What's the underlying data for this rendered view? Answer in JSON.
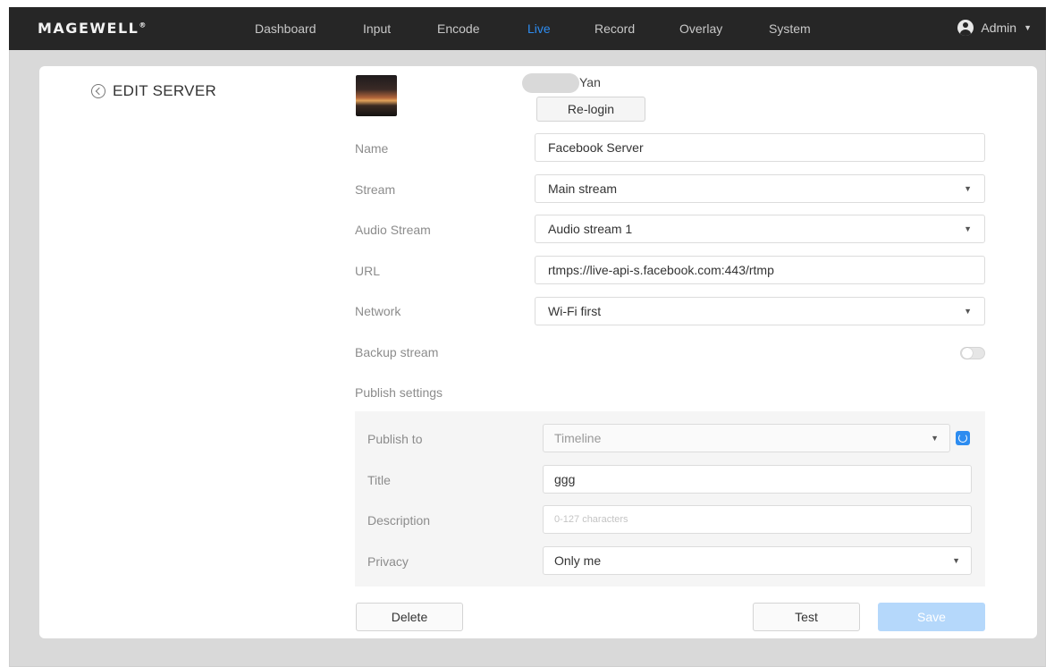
{
  "brand": {
    "logo_text": "MAGEWELL",
    "logo_mark": "®"
  },
  "nav": {
    "items": [
      "Dashboard",
      "Input",
      "Encode",
      "Live",
      "Record",
      "Overlay",
      "System"
    ],
    "active": "Live"
  },
  "user_menu": {
    "label": "Admin"
  },
  "page": {
    "title": "EDIT SERVER"
  },
  "account": {
    "name_suffix": "Yan",
    "relogin_label": "Re-login"
  },
  "form": {
    "name": {
      "label": "Name",
      "value": "Facebook Server"
    },
    "stream": {
      "label": "Stream",
      "value": "Main stream"
    },
    "audio_stream": {
      "label": "Audio Stream",
      "value": "Audio stream 1"
    },
    "url": {
      "label": "URL",
      "value": "rtmps://live-api-s.facebook.com:443/rtmp"
    },
    "network": {
      "label": "Network",
      "value": "Wi-Fi first"
    },
    "backup_stream": {
      "label": "Backup stream",
      "enabled": false
    },
    "publish_settings_label": "Publish settings"
  },
  "publish": {
    "publish_to": {
      "label": "Publish to",
      "value": "Timeline"
    },
    "title": {
      "label": "Title",
      "value": "ggg"
    },
    "description": {
      "label": "Description",
      "placeholder": "0-127 characters",
      "value": ""
    },
    "privacy": {
      "label": "Privacy",
      "value": "Only me"
    }
  },
  "actions": {
    "delete": "Delete",
    "test": "Test",
    "save": "Save"
  },
  "colors": {
    "accent": "#2d8cf0",
    "topbar": "#262626",
    "save_disabled": "#b5d8fb"
  }
}
